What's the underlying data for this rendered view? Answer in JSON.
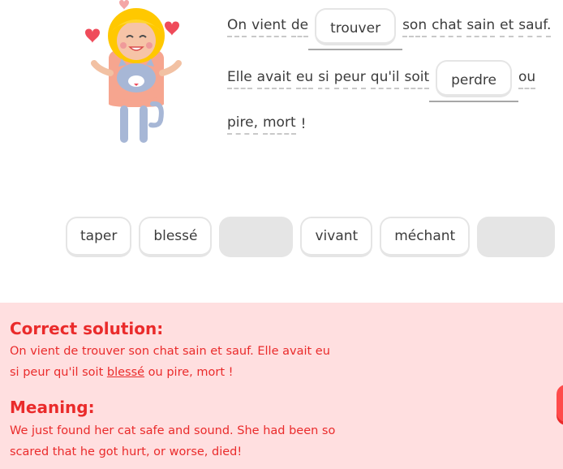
{
  "sentence": {
    "line1": {
      "before": [
        "On",
        "vient",
        "de"
      ],
      "answer": "trouver",
      "after": [
        "son",
        "chat",
        "sain",
        "et",
        "sauf."
      ]
    },
    "line2": {
      "before": [
        "Elle",
        "avait",
        "eu",
        "si",
        "peur",
        "qu'il",
        "soit"
      ],
      "answer": "perdre",
      "after": [
        "ou"
      ]
    },
    "line3": {
      "words": [
        "pire,",
        "mort",
        "!"
      ]
    }
  },
  "word_bank": [
    {
      "label": "taper",
      "used": false
    },
    {
      "label": "blessé",
      "used": false
    },
    {
      "label": "",
      "used": true
    },
    {
      "label": "vivant",
      "used": false
    },
    {
      "label": "méchant",
      "used": false
    },
    {
      "label": "",
      "used": true
    }
  ],
  "feedback": {
    "correct_heading": "Correct solution:",
    "correct_line1": "On vient de trouver son chat sain et sauf. Elle avait eu",
    "correct_line2_before": "si peur qu'il soit ",
    "correct_line2_highlight": "blessé",
    "correct_line2_after": " ou pire, mort !",
    "meaning_heading": "Meaning:",
    "meaning_line1": "We just found her cat safe and sound. She had been so",
    "meaning_line2": "scared that he got hurt, or worse, died!"
  },
  "colors": {
    "error": "#ea2b2b",
    "feedback_bg": "#ffdfe0",
    "chip_border": "#e5e5e5"
  }
}
